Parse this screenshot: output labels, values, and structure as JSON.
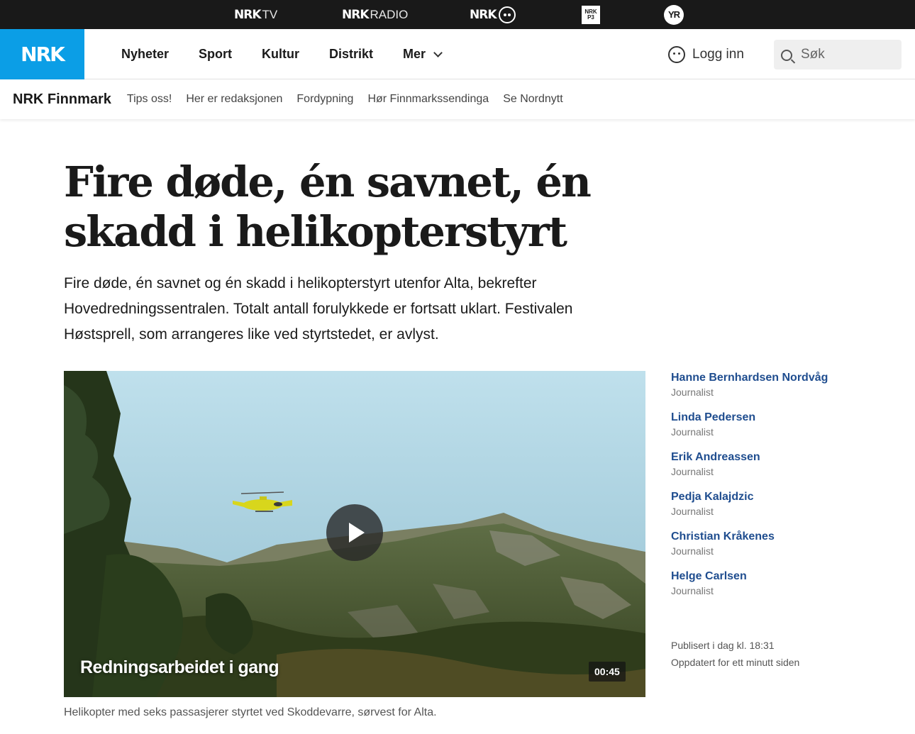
{
  "topbar": {
    "services": [
      {
        "brand": "NRK",
        "suffix": "TV"
      },
      {
        "brand": "NRK",
        "suffix": "RADIO"
      },
      {
        "brand": "NRK",
        "suffix": ""
      },
      {
        "brand": "NRK P3",
        "suffix": ""
      },
      {
        "brand": "YR",
        "suffix": ""
      }
    ]
  },
  "header": {
    "logo": "NRK",
    "nav": [
      "Nyheter",
      "Sport",
      "Kultur",
      "Distrikt",
      "Mer"
    ],
    "login_label": "Logg inn",
    "search_placeholder": "Søk"
  },
  "subnav": {
    "region": "NRK Finnmark",
    "links": [
      "Tips oss!",
      "Her er redaksjonen",
      "Fordypning",
      "Hør Finnmarkssendinga",
      "Se Nordnytt"
    ]
  },
  "article": {
    "headline": "Fire døde, én savnet, én skadd i helikopterstyrt",
    "lead": "Fire døde, én savnet og én skadd i helikopterstyrt utenfor Alta, bekrefter Hovedredningssentralen. Totalt antall forulykkede er fortsatt uklart. Festivalen Høstsprell, som arrangeres like ved styrtstedet, er avlyst.",
    "video": {
      "title": "Redningsarbeidet i gang",
      "duration": "00:45"
    },
    "caption": "Helikopter med seks passasjerer styrtet ved Skoddevarre, sørvest for Alta."
  },
  "authors": [
    {
      "name": "Hanne Bernhardsen Nordvåg",
      "role": "Journalist"
    },
    {
      "name": "Linda Pedersen",
      "role": "Journalist"
    },
    {
      "name": "Erik Andreassen",
      "role": "Journalist"
    },
    {
      "name": "Pedja Kalajdzic",
      "role": "Journalist"
    },
    {
      "name": "Christian Kråkenes",
      "role": "Journalist"
    },
    {
      "name": "Helge Carlsen",
      "role": "Journalist"
    }
  ],
  "meta": {
    "published": "Publisert i dag kl. 18:31",
    "updated": "Oppdatert for ett minutt siden"
  },
  "colors": {
    "brand_blue": "#0b9ee6",
    "topbar_bg": "#191919",
    "author_link": "#1f4d8f",
    "helicopter": "#d8d61c"
  }
}
